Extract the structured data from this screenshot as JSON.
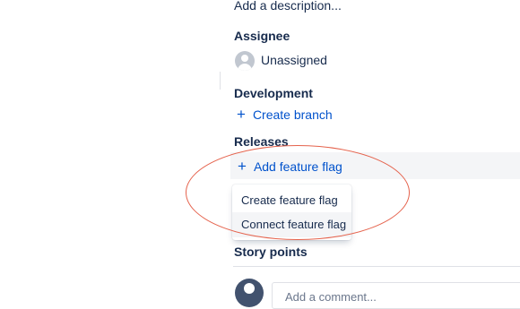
{
  "description": {
    "placeholder": "Add a description..."
  },
  "assignee": {
    "heading": "Assignee",
    "value": "Unassigned"
  },
  "development": {
    "heading": "Development",
    "create_branch": "Create branch"
  },
  "releases": {
    "heading": "Releases",
    "add_feature_flag": "Add feature flag",
    "menu": [
      "Create feature flag",
      "Connect feature flag"
    ]
  },
  "story_points": {
    "heading": "Story points"
  },
  "comment": {
    "placeholder": "Add a comment..."
  },
  "icons": {
    "plus": "+",
    "avatar": "user-avatar-icon"
  },
  "colors": {
    "link": "#0052CC",
    "annotation": "#E5634D",
    "text": "#172B4D"
  }
}
